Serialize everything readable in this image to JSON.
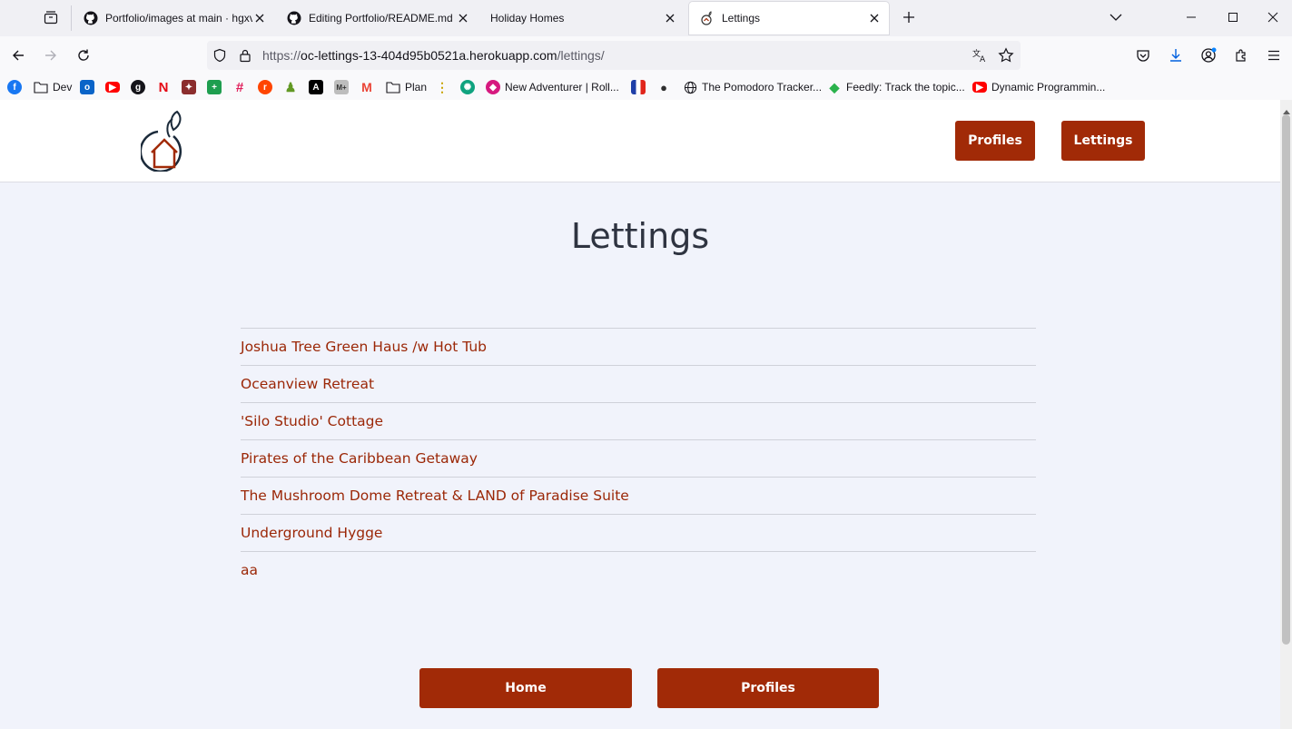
{
  "browser": {
    "tabs": [
      {
        "title": "Portfolio/images at main · hgxv",
        "icon": "github-icon",
        "active": false
      },
      {
        "title": "Editing Portfolio/README.md a",
        "icon": "github-icon",
        "active": false
      },
      {
        "title": "Holiday Homes",
        "icon": "",
        "active": false
      },
      {
        "title": "Lettings",
        "icon": "site-logo-icon",
        "active": true
      }
    ],
    "url": {
      "scheme": "https://",
      "host": "oc-lettings-13-404d95b0521a.herokuapp.com",
      "path": "/lettings/"
    },
    "bookmarks": [
      {
        "label": "",
        "icon": "facebook-icon",
        "color": "#1877f2"
      },
      {
        "label": "Dev",
        "icon": "folder-icon",
        "color": "#5b5b66"
      },
      {
        "label": "",
        "icon": "outlook-icon",
        "color": "#0a64c8"
      },
      {
        "label": "",
        "icon": "youtube-icon",
        "color": "#ff0000"
      },
      {
        "label": "",
        "icon": "github-icon",
        "color": "#15141a"
      },
      {
        "label": "",
        "icon": "netflix-icon",
        "color": "#e50914"
      },
      {
        "label": "",
        "icon": "creature-icon",
        "color": "#8b2d2d"
      },
      {
        "label": "",
        "icon": "sheet-icon",
        "color": "#1e9e4f"
      },
      {
        "label": "",
        "icon": "slack-icon",
        "color": "#4a154b"
      },
      {
        "label": "",
        "icon": "reddit-icon",
        "color": "#ff4500"
      },
      {
        "label": "",
        "icon": "chess-icon",
        "color": "#629924"
      },
      {
        "label": "",
        "icon": "app-icon",
        "color": "#000000"
      },
      {
        "label": "",
        "icon": "mplus-icon",
        "color": "#6b6b6b"
      },
      {
        "label": "",
        "icon": "gmail-icon",
        "color": "#ea4335"
      },
      {
        "label": "Plan",
        "icon": "folder-icon",
        "color": "#5b5b66"
      },
      {
        "label": "",
        "icon": "dots-icon",
        "color": "#c9a300"
      },
      {
        "label": "",
        "icon": "openai-icon",
        "color": "#10a37f"
      },
      {
        "label": "New Adventurer | Roll...",
        "icon": "dice-icon",
        "color": "#d6197f"
      },
      {
        "label": "",
        "icon": "flag-icon",
        "color": "#1f3fa8"
      },
      {
        "label": "",
        "icon": "turtle-icon",
        "color": "#2f2f2f"
      },
      {
        "label": "The Pomodoro Tracker...",
        "icon": "globe-icon",
        "color": "#5b5b66"
      },
      {
        "label": "Feedly: Track the topic...",
        "icon": "feedly-icon",
        "color": "#2bb24c"
      },
      {
        "label": "Dynamic Programmin...",
        "icon": "youtube-icon",
        "color": "#ff0000"
      }
    ]
  },
  "header": {
    "profiles_label": "Profiles",
    "lettings_label": "Lettings"
  },
  "main": {
    "title": "Lettings",
    "lettings": [
      "Joshua Tree Green Haus /w Hot Tub",
      "Oceanview Retreat",
      "'Silo Studio' Cottage",
      "Pirates of the Caribbean Getaway",
      "The Mushroom Dome Retreat & LAND of Paradise Suite",
      "Underground Hygge",
      "aa"
    ]
  },
  "footer": {
    "home_label": "Home",
    "profiles_label": "Profiles"
  },
  "colors": {
    "accent": "#a12a07",
    "link": "#9b2707",
    "background": "#f1f3fb"
  }
}
